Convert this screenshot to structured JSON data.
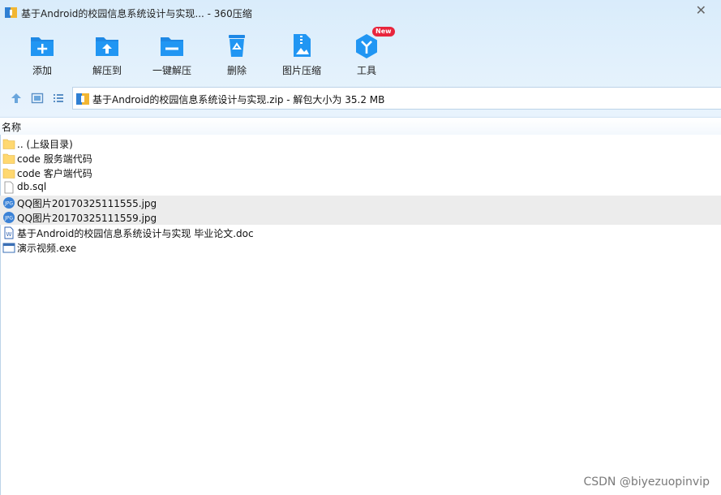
{
  "window": {
    "title": "基于Android的校园信息系统设计与实现... - 360压缩",
    "close_glyph": "✕"
  },
  "toolbar": {
    "buttons": [
      {
        "label": "添加",
        "icon": "add-folder-icon"
      },
      {
        "label": "解压到",
        "icon": "extract-to-icon"
      },
      {
        "label": "一键解压",
        "icon": "one-click-extract-icon"
      },
      {
        "label": "删除",
        "icon": "recycle-bin-icon"
      },
      {
        "label": "图片压缩",
        "icon": "image-compress-icon"
      },
      {
        "label": "工具",
        "icon": "tools-icon",
        "badge": "New"
      }
    ]
  },
  "nav": {
    "path_text": "基于Android的校园信息系统设计与实现.zip - 解包大小为 35.2 MB"
  },
  "list": {
    "column_name": "名称",
    "rows": [
      {
        "name": ".. (上级目录)",
        "icon": "folder-icon",
        "selected": false
      },
      {
        "name": "code 服务端代码",
        "icon": "folder-icon",
        "selected": false
      },
      {
        "name": "code 客户端代码",
        "icon": "folder-icon",
        "selected": false
      },
      {
        "name": "db.sql",
        "icon": "file-icon",
        "selected": false
      },
      {
        "name": "QQ图片20170325111555.jpg",
        "icon": "jpg-icon",
        "selected": true
      },
      {
        "name": "QQ图片20170325111559.jpg",
        "icon": "jpg-icon",
        "selected": true
      },
      {
        "name": "基于Android的校园信息系统设计与实现 毕业论文.doc",
        "icon": "doc-icon",
        "selected": false
      },
      {
        "name": "演示视频.exe",
        "icon": "exe-icon",
        "selected": false
      }
    ]
  },
  "watermark": "CSDN @biyezuopinvip",
  "colors": {
    "accent": "#1e88e5",
    "header_bg": "#dfeefb",
    "selected_row": "#ececec",
    "badge": "#e8253c",
    "folder": "#ffd870"
  }
}
